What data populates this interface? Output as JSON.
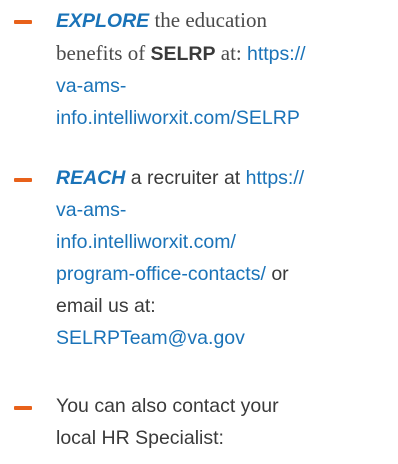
{
  "colors": {
    "accent": "#1a73b8",
    "dash": "#e8611a",
    "text": "#3a3a3a"
  },
  "items": [
    {
      "lead": "EXPLORE",
      "line1_rest": " the education",
      "line2_pre": "benefits of ",
      "line2_bold": "SELRP",
      "line2_post": " at: ",
      "link_1": "https://",
      "link_2": "va-ams-",
      "link_3": "info.intelliworxit.com/SELRP"
    },
    {
      "lead": "REACH",
      "line1_rest": " a recruiter at ",
      "link_1": "https://",
      "link_2": "va-ams-",
      "link_3": "info.intelliworxit.com/",
      "link_4": "program-office-contacts/",
      "after_link": " or",
      "line5": "email us at:",
      "email": "SELRPTeam@va.gov"
    },
    {
      "line1": "You can also contact your",
      "line2": "local HR Specialist:"
    }
  ]
}
